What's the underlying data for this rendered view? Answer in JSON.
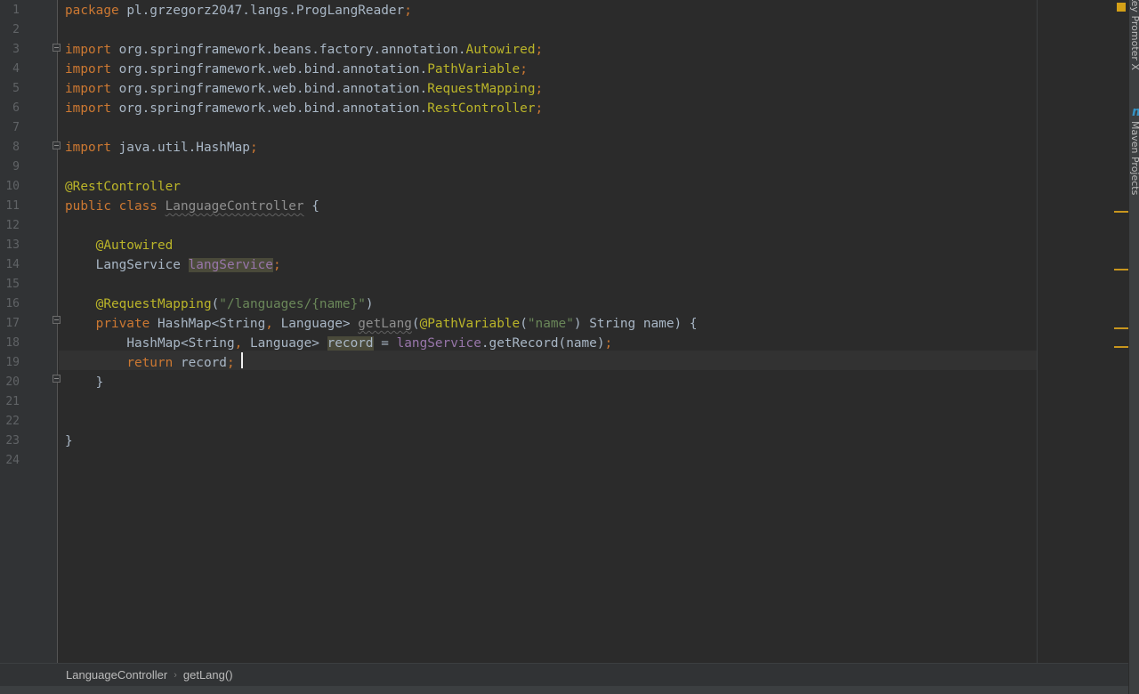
{
  "editor": {
    "line_numbers": [
      "1",
      "2",
      "3",
      "4",
      "5",
      "6",
      "7",
      "8",
      "9",
      "10",
      "11",
      "12",
      "13",
      "14",
      "15",
      "16",
      "17",
      "18",
      "19",
      "20",
      "21",
      "22",
      "23",
      "24"
    ],
    "code": {
      "l1_kw": "package",
      "l1_rest": " pl.grzegorz2047.langs.ProgLangReader",
      "l1_semi": ";",
      "import_kw": "import",
      "l3_pkg": " org.springframework.beans.factory.annotation.",
      "l3_cls": "Autowired",
      "l4_pkg": " org.springframework.web.bind.annotation.",
      "l4_cls": "PathVariable",
      "l5_pkg": " org.springframework.web.bind.annotation.",
      "l5_cls": "RequestMapping",
      "l6_pkg": " org.springframework.web.bind.annotation.",
      "l6_cls": "RestController",
      "l8_rest": " java.util.HashMap",
      "semi": ";",
      "l10_ann": "@RestController",
      "l11_kw": "public class ",
      "l11_cls": "LanguageController",
      "l11_rest": " {",
      "l13_ann": "@Autowired",
      "l14_type": "LangService ",
      "l14_field": "langService",
      "l16_ann": "@RequestMapping",
      "l16_open": "(",
      "l16_str": "\"/languages/{name}\"",
      "l16_close": ")",
      "l17_kw": "private ",
      "l17_type": "HashMap<String",
      "l17_comma": ",",
      "l17_type2": " Language> ",
      "l17_method": "getLang",
      "l17_open": "(",
      "l17_ann": "@PathVariable",
      "l17_paren": "(",
      "l17_str": "\"name\"",
      "l17_rest": ") String name) {",
      "l18_type": "HashMap<String",
      "l18_comma": ",",
      "l18_type2": " Language> ",
      "l18_var": "record",
      "l18_eq": " = ",
      "l18_field": "langService",
      "l18_rest": ".getRecord(name)",
      "l19_kw": "return",
      "l19_rest": " record",
      "l20": "}",
      "l23": "}"
    }
  },
  "side_tabs": {
    "top": "Key Promoter X",
    "maven": "Maven Projects",
    "icon": "m"
  },
  "breadcrumb": {
    "items": [
      "LanguageController",
      "getLang()"
    ],
    "separator": "›"
  },
  "colors": {
    "background": "#2b2b2b",
    "keyword": "#cc7832",
    "annotation": "#bbb529",
    "string": "#6a8759",
    "field": "#9876aa",
    "text": "#a9b7c6"
  }
}
